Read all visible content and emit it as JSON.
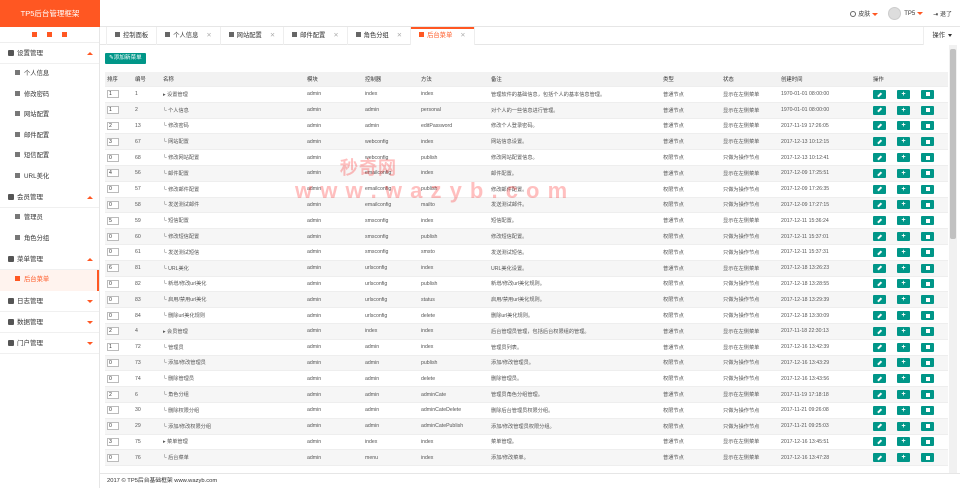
{
  "app": {
    "logo": "TP5后台管理框架",
    "skin_label": "皮肤",
    "user_name": "TP5",
    "logout_label": "退了"
  },
  "sidebar": {
    "groups": [
      {
        "label": "设置管理",
        "expanded": true,
        "items": [
          "个人信息",
          "修改密码",
          "网站配置",
          "邮件配置",
          "短信配置",
          "URL美化"
        ]
      },
      {
        "label": "会员管理",
        "expanded": true,
        "items": [
          "管理员",
          "角色分组"
        ]
      },
      {
        "label": "菜单管理",
        "expanded": true,
        "items": [
          "后台菜单"
        ]
      },
      {
        "label": "日志管理",
        "expanded": false,
        "items": []
      },
      {
        "label": "数据管理",
        "expanded": false,
        "items": []
      },
      {
        "label": "门户管理",
        "expanded": false,
        "items": []
      }
    ],
    "active_item": "后台菜单"
  },
  "tabs": {
    "items": [
      {
        "label": "控制面板",
        "icon": "home-icon",
        "closable": false
      },
      {
        "label": "个人信息",
        "icon": "gear-icon",
        "closable": true
      },
      {
        "label": "网站配置",
        "icon": "monitor-icon",
        "closable": true
      },
      {
        "label": "邮件配置",
        "icon": "mail-icon",
        "closable": true
      },
      {
        "label": "角色分组",
        "icon": "users-icon",
        "closable": true
      },
      {
        "label": "后台菜单",
        "icon": "menu-icon",
        "closable": true,
        "active": true
      }
    ],
    "ops_label": "操作"
  },
  "toolbar": {
    "add_label": "添加新菜单"
  },
  "table": {
    "headers": [
      "排序",
      "编号",
      "名称",
      "模块",
      "控制器",
      "方法",
      "备注",
      "类型",
      "状态",
      "创建时间",
      "操作"
    ],
    "rows": [
      {
        "sort": "1",
        "id": "1",
        "name": "▸ 设置管理",
        "module": "admin",
        "controller": "index",
        "method": "index",
        "note": "管理软件的基础信息，包括个人的基本信息管理。",
        "type": "普通节点",
        "status": "显示在左侧菜单",
        "created": "1970-01-01 08:00:00"
      },
      {
        "sort": "1",
        "id": "2",
        "name": "└ 个人信息",
        "module": "admin",
        "controller": "admin",
        "method": "personal",
        "note": "对个人的一些信息进行管理。",
        "type": "普通节点",
        "status": "显示在左侧菜单",
        "created": "1970-01-01 08:00:00"
      },
      {
        "sort": "2",
        "id": "13",
        "name": "└ 修改密码",
        "module": "admin",
        "controller": "admin",
        "method": "editPassword",
        "note": "修改个人登录密码。",
        "type": "普通节点",
        "status": "显示在左侧菜单",
        "created": "2017-11-19 17:26:05"
      },
      {
        "sort": "3",
        "id": "67",
        "name": "└ 网站配置",
        "module": "admin",
        "controller": "webconfig",
        "method": "index",
        "note": "网站信息设置。",
        "type": "普通节点",
        "status": "显示在左侧菜单",
        "created": "2017-12-13 10:12:15"
      },
      {
        "sort": "0",
        "id": "68",
        "name": "└ 修改网站配置",
        "module": "admin",
        "controller": "webconfig",
        "method": "publish",
        "note": "修改网站配置信息。",
        "type": "权限节点",
        "status": "只做为操作节点",
        "created": "2017-12-13 10:12:41"
      },
      {
        "sort": "4",
        "id": "56",
        "name": "└ 邮件配置",
        "module": "admin",
        "controller": "emailconfig",
        "method": "index",
        "note": "邮件配置。",
        "type": "普通节点",
        "status": "显示在左侧菜单",
        "created": "2017-12-09 17:25:51"
      },
      {
        "sort": "0",
        "id": "57",
        "name": "└ 修改邮件配置",
        "module": "admin",
        "controller": "emailconfig",
        "method": "publish",
        "note": "修改邮件配置。",
        "type": "权限节点",
        "status": "只做为操作节点",
        "created": "2017-12-09 17:26:35"
      },
      {
        "sort": "0",
        "id": "58",
        "name": "└ 发送测试邮件",
        "module": "admin",
        "controller": "emailconfig",
        "method": "mailto",
        "note": "发送测试邮件。",
        "type": "权限节点",
        "status": "只做为操作节点",
        "created": "2017-12-09 17:27:15"
      },
      {
        "sort": "5",
        "id": "59",
        "name": "└ 短信配置",
        "module": "admin",
        "controller": "smsconfig",
        "method": "index",
        "note": "短信配置。",
        "type": "普通节点",
        "status": "显示在左侧菜单",
        "created": "2017-12-11 15:36:24"
      },
      {
        "sort": "0",
        "id": "60",
        "name": "└ 修改短信配置",
        "module": "admin",
        "controller": "smsconfig",
        "method": "publish",
        "note": "修改短信配置。",
        "type": "权限节点",
        "status": "只做为操作节点",
        "created": "2017-12-11 15:37:01"
      },
      {
        "sort": "0",
        "id": "61",
        "name": "└ 发送测试短信",
        "module": "admin",
        "controller": "smsconfig",
        "method": "smsto",
        "note": "发送测试短信。",
        "type": "权限节点",
        "status": "只做为操作节点",
        "created": "2017-12-11 15:37:31"
      },
      {
        "sort": "6",
        "id": "81",
        "name": "└ URL美化",
        "module": "admin",
        "controller": "urlsconfig",
        "method": "index",
        "note": "URL美化设置。",
        "type": "普通节点",
        "status": "显示在左侧菜单",
        "created": "2017-12-18 13:26:23"
      },
      {
        "sort": "0",
        "id": "82",
        "name": "└ 新增/修改url美化",
        "module": "admin",
        "controller": "urlsconfig",
        "method": "publish",
        "note": "新增/修改url美化规则。",
        "type": "权限节点",
        "status": "只做为操作节点",
        "created": "2017-12-18 13:28:55"
      },
      {
        "sort": "0",
        "id": "83",
        "name": "└ 启用/禁用url美化",
        "module": "admin",
        "controller": "urlsconfig",
        "method": "status",
        "note": "启用/禁用url美化规则。",
        "type": "权限节点",
        "status": "只做为操作节点",
        "created": "2017-12-18 13:29:39"
      },
      {
        "sort": "0",
        "id": "84",
        "name": "└ 删除url美化规则",
        "module": "admin",
        "controller": "urlsconfig",
        "method": "delete",
        "note": "删除url美化规则。",
        "type": "权限节点",
        "status": "只做为操作节点",
        "created": "2017-12-18 13:30:09"
      },
      {
        "sort": "2",
        "id": "4",
        "name": "▸ 会员管理",
        "module": "admin",
        "controller": "index",
        "method": "index",
        "note": "后台管理员管理，包括后台权限组的管理。",
        "type": "普通节点",
        "status": "显示在左侧菜单",
        "created": "2017-11-18 22:30:13"
      },
      {
        "sort": "1",
        "id": "72",
        "name": "└ 管理员",
        "module": "admin",
        "controller": "admin",
        "method": "index",
        "note": "管理员列表。",
        "type": "普通节点",
        "status": "显示在左侧菜单",
        "created": "2017-12-16 13:42:39"
      },
      {
        "sort": "0",
        "id": "73",
        "name": "└ 添加/修改管理员",
        "module": "admin",
        "controller": "admin",
        "method": "publish",
        "note": "添加/修改管理员。",
        "type": "权限节点",
        "status": "只做为操作节点",
        "created": "2017-12-16 13:43:29"
      },
      {
        "sort": "0",
        "id": "74",
        "name": "└ 删除管理员",
        "module": "admin",
        "controller": "admin",
        "method": "delete",
        "note": "删除管理员。",
        "type": "权限节点",
        "status": "只做为操作节点",
        "created": "2017-12-16 13:43:56"
      },
      {
        "sort": "2",
        "id": "6",
        "name": "└ 角色分组",
        "module": "admin",
        "controller": "admin",
        "method": "adminCate",
        "note": "管理员角色分组管理。",
        "type": "普通节点",
        "status": "显示在左侧菜单",
        "created": "2017-11-19 17:18:18"
      },
      {
        "sort": "0",
        "id": "30",
        "name": "└ 删除权限分组",
        "module": "admin",
        "controller": "admin",
        "method": "adminCateDelete",
        "note": "删除后台管理员权限分组。",
        "type": "权限节点",
        "status": "只做为操作节点",
        "created": "2017-11-21 09:26:08"
      },
      {
        "sort": "0",
        "id": "29",
        "name": "└ 添加/修改权限分组",
        "module": "admin",
        "controller": "admin",
        "method": "adminCatePublish",
        "note": "添加/修改管理员权限分组。",
        "type": "权限节点",
        "status": "只做为操作节点",
        "created": "2017-11-21 09:25:03"
      },
      {
        "sort": "3",
        "id": "75",
        "name": "▸ 菜单管理",
        "module": "admin",
        "controller": "index",
        "method": "index",
        "note": "菜单管理。",
        "type": "普通节点",
        "status": "显示在左侧菜单",
        "created": "2017-12-16 13:45:51"
      },
      {
        "sort": "0",
        "id": "76",
        "name": "└ 后台菜单",
        "module": "admin",
        "controller": "menu",
        "method": "index",
        "note": "添加/修改菜单。",
        "type": "普通节点",
        "status": "显示在左侧菜单",
        "created": "2017-12-16 13:47:28"
      }
    ]
  },
  "watermark": {
    "line1": "秒奇网",
    "line2": "w w w . w a z y b . c o m"
  },
  "footer": {
    "text": "2017 © TP5后台基础框架 www.wazyb.com"
  }
}
